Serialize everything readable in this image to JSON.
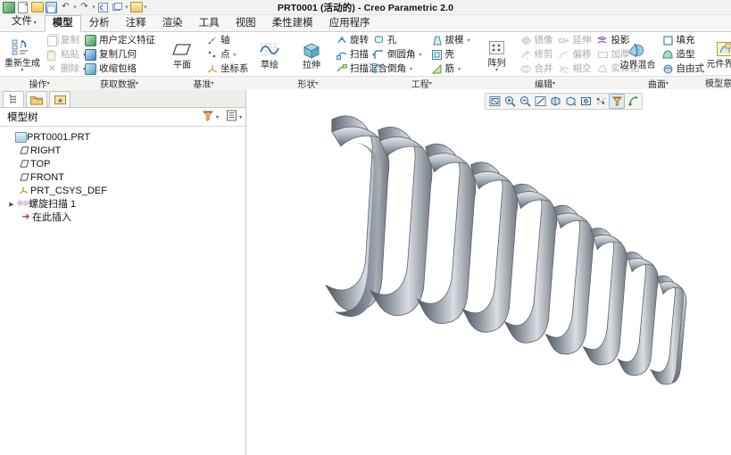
{
  "window": {
    "title": "PRT0001 (活动的) - Creo Parametric 2.0"
  },
  "quick_access": {
    "items": [
      {
        "name": "app-logo-icon",
        "label": ""
      },
      {
        "name": "new-file-icon",
        "label": ""
      },
      {
        "name": "open-file-icon",
        "label": ""
      },
      {
        "name": "save-icon",
        "label": ""
      },
      {
        "name": "undo-icon",
        "label": "↶"
      },
      {
        "name": "redo-icon",
        "label": "↷"
      },
      {
        "name": "regenerate-icon",
        "label": ""
      },
      {
        "name": "window-icon",
        "label": ""
      },
      {
        "name": "close-window-icon",
        "label": ""
      },
      {
        "name": "customize-qat-icon",
        "label": "▾"
      }
    ]
  },
  "tabs": [
    {
      "label": "文件",
      "active": false,
      "has_caret": true
    },
    {
      "label": "模型",
      "active": true,
      "has_caret": false
    },
    {
      "label": "分析",
      "active": false,
      "has_caret": false
    },
    {
      "label": "注释",
      "active": false,
      "has_caret": false
    },
    {
      "label": "渲染",
      "active": false,
      "has_caret": false
    },
    {
      "label": "工具",
      "active": false,
      "has_caret": false
    },
    {
      "label": "视图",
      "active": false,
      "has_caret": false
    },
    {
      "label": "柔性建模",
      "active": false,
      "has_caret": false
    },
    {
      "label": "应用程序",
      "active": false,
      "has_caret": false
    }
  ],
  "ribbon": {
    "groups": [
      {
        "label": "操作",
        "big": [
          {
            "label": "重新生成",
            "icon": "regenerate-icon",
            "caret": true
          }
        ],
        "small": [
          {
            "label": "复制",
            "icon": "copy-icon",
            "disabled": true,
            "caret": false
          },
          {
            "label": "粘贴",
            "icon": "paste-icon",
            "disabled": true,
            "caret": true
          },
          {
            "label": "删除",
            "icon": "delete-icon",
            "disabled": true,
            "caret": true
          }
        ]
      },
      {
        "label": "获取数据",
        "big": [],
        "small": [
          {
            "label": "用户定义特征",
            "icon": "udf-icon",
            "disabled": false,
            "caret": false
          },
          {
            "label": "复制几何",
            "icon": "copy-geometry-icon",
            "disabled": false,
            "caret": false
          },
          {
            "label": "收缩包络",
            "icon": "shrinkwrap-icon",
            "disabled": false,
            "caret": false
          }
        ]
      },
      {
        "label": "基准",
        "big": [
          {
            "label": "平面",
            "icon": "datum-plane-icon",
            "caret": false
          }
        ],
        "small": [
          {
            "label": "轴",
            "icon": "datum-axis-icon",
            "disabled": false,
            "caret": false
          },
          {
            "label": "点",
            "icon": "datum-point-icon",
            "disabled": false,
            "caret": true
          },
          {
            "label": "坐标系",
            "icon": "coordinate-system-icon",
            "disabled": false,
            "caret": false
          }
        ]
      },
      {
        "label": "形状",
        "big": [
          {
            "label": "草绘",
            "icon": "sketch-icon",
            "caret": false
          },
          {
            "label": "拉伸",
            "icon": "extrude-icon",
            "caret": false
          }
        ],
        "small": [
          {
            "label": "旋转",
            "icon": "revolve-icon",
            "disabled": false,
            "caret": false
          },
          {
            "label": "扫描",
            "icon": "sweep-icon",
            "disabled": false,
            "caret": true
          },
          {
            "label": "扫描混合",
            "icon": "swept-blend-icon",
            "disabled": false,
            "caret": false
          }
        ]
      },
      {
        "label": "工程",
        "big": [],
        "small": [
          {
            "label": "孔",
            "icon": "hole-icon",
            "disabled": false,
            "caret": false
          },
          {
            "label": "倒圆角",
            "icon": "round-icon",
            "disabled": false,
            "caret": true
          },
          {
            "label": "倒角",
            "icon": "chamfer-icon",
            "disabled": false,
            "caret": true
          }
        ],
        "small2": [
          {
            "label": "拔模",
            "icon": "draft-icon",
            "disabled": false,
            "caret": true
          },
          {
            "label": "壳",
            "icon": "shell-icon",
            "disabled": false,
            "caret": false
          },
          {
            "label": "筋",
            "icon": "rib-icon",
            "disabled": false,
            "caret": true
          }
        ]
      },
      {
        "label": "编辑",
        "big": [
          {
            "label": "阵列",
            "icon": "pattern-icon",
            "caret": true
          }
        ],
        "small": [
          {
            "label": "镜像",
            "icon": "mirror-icon",
            "disabled": true,
            "caret": false
          },
          {
            "label": "修剪",
            "icon": "trim-icon",
            "disabled": true,
            "caret": false
          },
          {
            "label": "合并",
            "icon": "merge-icon",
            "disabled": true,
            "caret": false
          }
        ],
        "small2": [
          {
            "label": "延伸",
            "icon": "extend-icon",
            "disabled": true,
            "caret": false
          },
          {
            "label": "偏移",
            "icon": "offset-icon",
            "disabled": true,
            "caret": false
          },
          {
            "label": "相交",
            "icon": "intersect-icon",
            "disabled": true,
            "caret": false
          }
        ],
        "small3": [
          {
            "label": "投影",
            "icon": "project-icon",
            "disabled": false,
            "caret": false
          },
          {
            "label": "加厚",
            "icon": "thicken-icon",
            "disabled": true,
            "caret": false
          },
          {
            "label": "实体化",
            "icon": "solidify-icon",
            "disabled": true,
            "caret": false
          }
        ]
      },
      {
        "label": "曲面",
        "big": [
          {
            "label": "边界混合",
            "icon": "boundary-blend-icon",
            "caret": false
          }
        ],
        "small": [
          {
            "label": "填充",
            "icon": "fill-icon",
            "disabled": false,
            "caret": false
          },
          {
            "label": "造型",
            "icon": "style-icon",
            "disabled": false,
            "caret": false
          },
          {
            "label": "自由式",
            "icon": "freestyle-icon",
            "disabled": false,
            "caret": false
          }
        ]
      },
      {
        "label": "模型意图",
        "big": [
          {
            "label": "元件界面",
            "icon": "component-interface-icon",
            "caret": false
          }
        ],
        "small": []
      }
    ]
  },
  "sidebar": {
    "mini_tabs": [
      {
        "name": "model-tree-tab",
        "active": true
      },
      {
        "name": "folder-browser-tab",
        "active": false
      },
      {
        "name": "favorites-tab",
        "active": false
      }
    ],
    "tree_header": {
      "title": "模型树",
      "filter_icon": "filter-icon",
      "settings_icon": "tree-settings-icon"
    },
    "tree": [
      {
        "label": "PRT0001.PRT",
        "icon": "part-icon",
        "level": 0,
        "expander": ""
      },
      {
        "label": "RIGHT",
        "icon": "datum-plane-icon",
        "level": 1,
        "expander": ""
      },
      {
        "label": "TOP",
        "icon": "datum-plane-icon",
        "level": 1,
        "expander": ""
      },
      {
        "label": "FRONT",
        "icon": "datum-plane-icon",
        "level": 1,
        "expander": ""
      },
      {
        "label": "PRT_CSYS_DEF",
        "icon": "coordinate-system-icon",
        "level": 1,
        "expander": ""
      },
      {
        "label": "螺旋扫描 1",
        "icon": "helical-sweep-icon",
        "level": 0,
        "expander": "▶"
      },
      {
        "label": "在此插入",
        "icon": "insert-here-icon",
        "level": 1,
        "expander": ""
      }
    ]
  },
  "graphics_toolbar": {
    "buttons": [
      {
        "name": "refit-icon",
        "active": false
      },
      {
        "name": "zoom-in-icon",
        "active": false
      },
      {
        "name": "zoom-out-icon",
        "active": false
      },
      {
        "name": "repaint-icon",
        "active": false
      },
      {
        "name": "display-style-icon",
        "active": false
      },
      {
        "name": "saved-orientations-icon",
        "active": false
      },
      {
        "name": "perspective-view-icon",
        "active": false
      },
      {
        "name": "datum-display-filters-icon",
        "active": false
      },
      {
        "name": "annotation-display-icon",
        "active": true
      },
      {
        "name": "spin-center-icon",
        "active": false
      }
    ]
  },
  "model": {
    "name": "conical-helical-spring",
    "color_light": "#d7dbe0",
    "color_mid": "#8b949e",
    "color_dark": "#4a5158",
    "background": "#ffffff"
  }
}
